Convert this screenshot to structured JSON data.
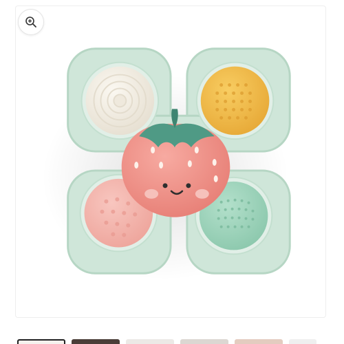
{
  "gallery": {
    "image_alt": "",
    "zoom_icon": "zoom-in-icon",
    "thumbnails": [
      "thumbnail-1",
      "thumbnail-2",
      "thumbnail-3",
      "thumbnail-4",
      "thumbnail-5",
      "thumbnail-6"
    ],
    "active_thumbnail": 1
  },
  "colors": {
    "base": "#cfe6d9",
    "base_edge": "#b6d6c4",
    "cup_white": "#f2ede4",
    "cup_yellow": "#f3bb45",
    "cup_pink": "#f3b6ae",
    "cup_green": "#9fd4bd",
    "strawberry": "#f08f86",
    "leaves": "#4f9a85"
  }
}
